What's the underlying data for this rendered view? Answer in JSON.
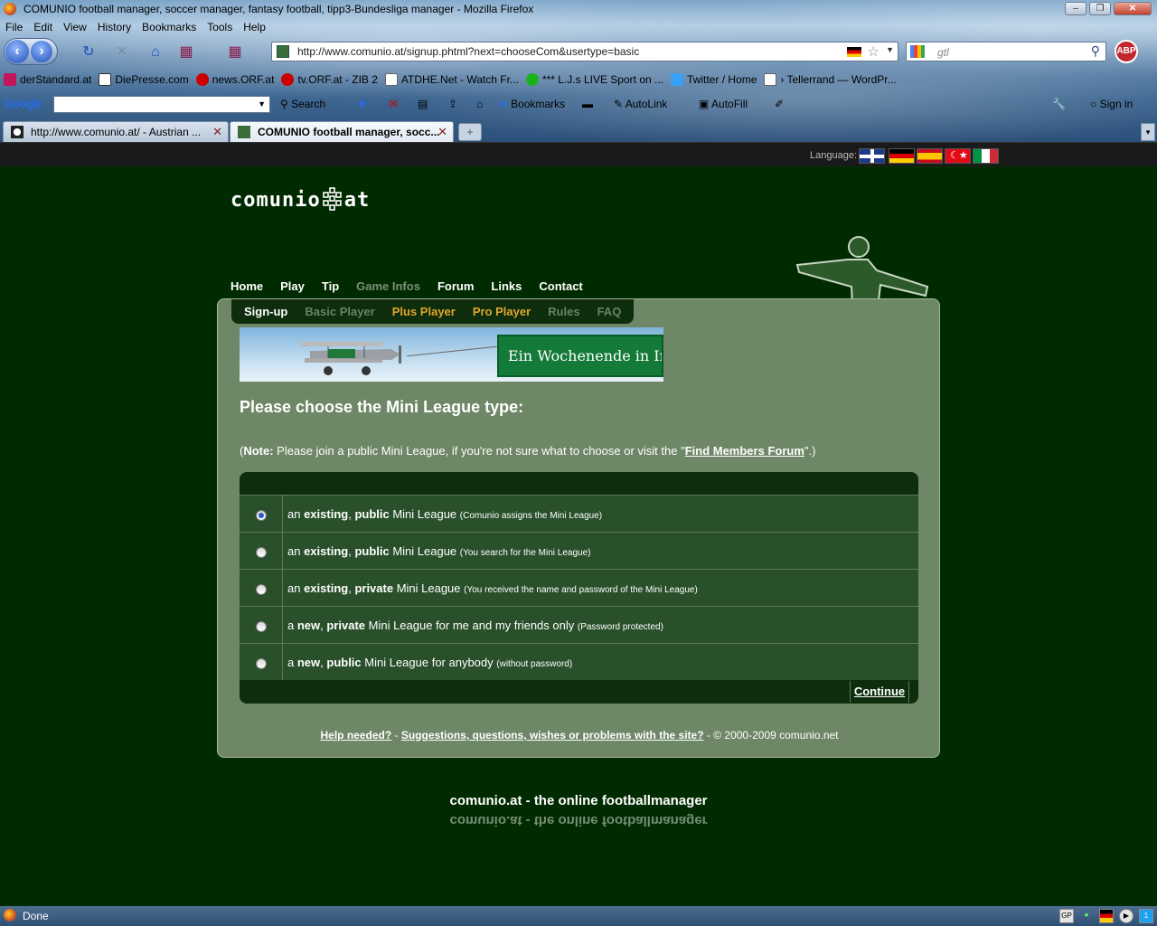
{
  "window": {
    "title": "COMUNIO football manager, soccer manager, fantasy football, tipp3-Bundesliga manager - Mozilla Firefox"
  },
  "menu": [
    "File",
    "Edit",
    "View",
    "History",
    "Bookmarks",
    "Tools",
    "Help"
  ],
  "address": {
    "url": "http://www.comunio.at/signup.phtml?next=chooseCom&usertype=basic",
    "search_value": "gtl"
  },
  "bookmarks": [
    "derStandard.at",
    "DiePresse.com",
    "news.ORF.at",
    "tv.ORF.at - ZIB 2",
    "ATDHE.Net - Watch Fr...",
    "*** L.J.s LIVE Sport on ...",
    "Twitter / Home",
    "› Tellerrand — WordPr..."
  ],
  "google_toolbar": {
    "logo": "Google",
    "search_label": "Search",
    "bookmarks_label": "Bookmarks",
    "autolink_label": "AutoLink",
    "autofill_label": "AutoFill",
    "signin_label": "Sign in"
  },
  "tabs": [
    {
      "label": "http://www.comunio.at/ - Austrian ..."
    },
    {
      "label": "COMUNIO football manager, socc..."
    }
  ],
  "page": {
    "language_label": "Language:",
    "logo_text_left": "comunio",
    "logo_text_right": "at",
    "topnav": [
      "Home",
      "Play",
      "Tip",
      "Game Infos",
      "Forum",
      "Links",
      "Contact"
    ],
    "subnav": [
      "Sign-up",
      "Basic Player",
      "Plus Player",
      "Pro Player",
      "Rules",
      "FAQ"
    ],
    "banner_text": "Ein Wochenende in Irl",
    "heading": "Please choose the Mini League type:",
    "note": {
      "open": "(",
      "bold": "Note:",
      "text": " Please join a public Mini League, if you're not sure what to choose or visit the \"",
      "link": "Find Members Forum",
      "close": "\".)"
    },
    "options": [
      {
        "pre": "an ",
        "b1": "existing",
        "mid": ", ",
        "b2": "public",
        "post": " Mini League ",
        "hint": "(Comunio assigns the Mini League)",
        "checked": true
      },
      {
        "pre": "an ",
        "b1": "existing",
        "mid": ", ",
        "b2": "public",
        "post": " Mini League ",
        "hint": "(You search for the Mini League)",
        "checked": false
      },
      {
        "pre": "an ",
        "b1": "existing",
        "mid": ", ",
        "b2": "private",
        "post": " Mini League ",
        "hint": "(You received the name and password of the Mini League)",
        "checked": false
      },
      {
        "pre": "a ",
        "b1": "new",
        "mid": ", ",
        "b2": "private",
        "post": " Mini League for me and my friends only ",
        "hint": "(Password protected)",
        "checked": false
      },
      {
        "pre": "a ",
        "b1": "new",
        "mid": ", ",
        "b2": "public",
        "post": " Mini League for anybody ",
        "hint": "(without password)",
        "checked": false
      }
    ],
    "continue_label": "Continue",
    "footer": {
      "help": "Help needed?",
      "sep": " - ",
      "suggest": "Suggestions, questions, wishes or problems with the site?",
      "copyright": " - © 2000-2009 comunio.net"
    },
    "tagline": "comunio.at - the online footballmanager"
  },
  "status": {
    "text": "Done",
    "tray_badge": "1"
  },
  "colors": {
    "page_bg": "#002b00",
    "panel_bg": "#6e8766",
    "row_bg": "#29502a",
    "accent_gold": "#e0a62a"
  }
}
